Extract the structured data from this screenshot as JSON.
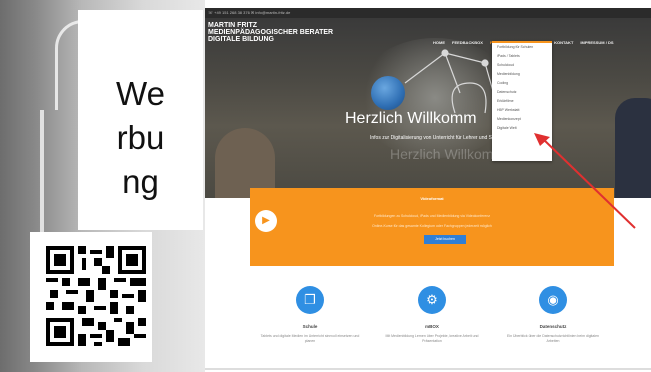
{
  "ad_label": {
    "line1": "We",
    "line2": "rbu",
    "line3": "ng"
  },
  "site": {
    "topbar_text": "☏ +49 151 268 38 376   ✉ info@martin-fritz.de",
    "logo": {
      "line1": "MARTIN FRITZ",
      "line2": "MEDIENPÄDAGOGISCHER BERATER",
      "line3": "DIGITALE BILDUNG"
    },
    "nav": [
      "HOME",
      "FEEDBACKBOX",
      "FORTBILDUNGEN",
      "MEDIEN",
      "KONTAKT",
      "IMPRESSUM / DS"
    ],
    "dropdown_items": [
      "Fortbildung für Schulen",
      "iPads / Tablets",
      "Schulcloud",
      "Medienbildung",
      "Coding",
      "Datenschutz",
      "Erklärfilme",
      "H5P Werkstatt",
      "Medienkonzept",
      "Digitale Welt"
    ],
    "hero": {
      "welcome": "Herzlich Willkomm",
      "subtitle": "Infos zur Digitalisierung von Unterricht für Lehrer und Schulen",
      "ghost": "Herzlich Willkom"
    },
    "band": {
      "title": "Videoformat",
      "line1": "Fortbildungen zu Schulcloud, iPads und Medienbildung via Videokonferenz",
      "line2": "Online-Kurse für das gesamte Kollegium oder Fachgruppen jederzeit möglich",
      "button": "Jetzt buchen"
    },
    "features": [
      {
        "title": "Schule",
        "icon": "copy-icon",
        "text": "Tablets und digitale Medien im Unterricht sinnvoll einsetzen und planen"
      },
      {
        "title": "mBOX",
        "icon": "gears-icon",
        "text": "Mit Medienbildung Lernen über Projekte, kreative Arbeit und Präsentation"
      },
      {
        "title": "Datenschutz",
        "icon": "lock-icon",
        "text": "Ein Überblick über die Datenschutzrichtlinien beim digitalen Arbeiten"
      }
    ]
  },
  "colors": {
    "accent": "#f7941d",
    "button_blue": "#2f7fd6",
    "arrow": "#e03030"
  }
}
